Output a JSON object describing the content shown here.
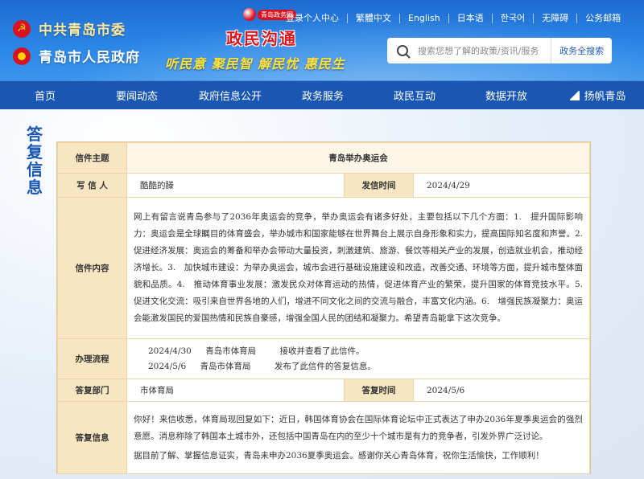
{
  "header": {
    "org_party": "中共青岛市委",
    "org_gov": "青岛市人民政府",
    "logo_badge": "青岛政务网",
    "logo_title": "政民沟通",
    "slogan": "听民意 聚民智 解民忧 惠民生",
    "top_links": [
      "登录个人中心",
      "繁體中文",
      "English",
      "日本语",
      "한국어",
      "无障碍",
      "公务邮箱"
    ],
    "search": {
      "placeholder": "搜索您想了解的政策/资讯/服务",
      "button": "政务全搜索"
    }
  },
  "nav": {
    "items": [
      "首页",
      "要闻动态",
      "政府信息公开",
      "政务服务",
      "政民互动",
      "数据开放",
      "扬帆青岛"
    ]
  },
  "side_title": "答复信息",
  "letter": {
    "subject_label": "信件主题",
    "subject": "青岛举办奥运会",
    "writer_label": "写 信 人",
    "writer": "酷酷的滕",
    "sent_time_label": "发信时间",
    "sent_time": "2024/4/29",
    "content_label": "信件内容",
    "content": "网上有留言说青岛参与了2036年奥运会的竞争，举办奥运会有诸多好处，主要包括以下几个方面：1.　提升国际影响力：奥运会是全球瞩目的体育盛会，举办城市和国家能够在世界舞台上展示自身形象和实力，提高国际知名度和声誉。2.　促进经济发展：奥运会的筹备和举办会带动大量投资，刺激建筑、旅游、餐饮等相关产业的发展，创造就业机会，推动经济增长。3.　加快城市建设：为举办奥运会，城市会进行基础设施建设和改造，改善交通、环境等方面，提升城市整体面貌和品质。4.　推动体育事业发展：激发民众对体育运动的热情，促进体育产业的繁荣，提升国家的体育竞技水平。5.　促进文化交流：吸引来自世界各地的人们，增进不同文化之间的交流与融合，丰富文化内涵。6.　增强民族凝聚力：奥运会能激发国民的爱国热情和民族自豪感，增强全国人民的团结和凝聚力。希望青岛能拿下这次竞争。",
    "process_label": "办理流程",
    "process": [
      {
        "date": "2024/4/30",
        "dept": "青岛市体育局",
        "action": "接收并查看了此信件。"
      },
      {
        "date": "2024/5/6",
        "dept": "青岛市体育局",
        "action": "发布了此信件的答复信息。"
      }
    ],
    "reply_dept_label": "答复部门",
    "reply_dept": "市体育局",
    "reply_time_label": "答复时间",
    "reply_time": "2024/5/6",
    "reply_label": "答复信息",
    "reply_p1": "你好！来信收悉，体育局现回复如下：近日，韩国体育协会在国际体育论坛中正式表达了申办2036年夏季奥运会的强烈意愿。消息称除了韩国本土城市外，还包括中国青岛在内的至少十个城市是有力的竞争者，引发外界广泛讨论。",
    "reply_p2": "据目前了解、掌握信息证实，青岛未申办2036夏季奥运会。感谢你关心青岛体育，祝你生活愉快，工作顺利！"
  },
  "colors": {
    "header_blue": "#1e6bd0",
    "nav_blue": "#1a56b4",
    "label_bg": "#f8e6c2",
    "label_text": "#1a3f8a",
    "logo_red": "#e0131b",
    "slogan_yellow": "#ffe23a"
  }
}
